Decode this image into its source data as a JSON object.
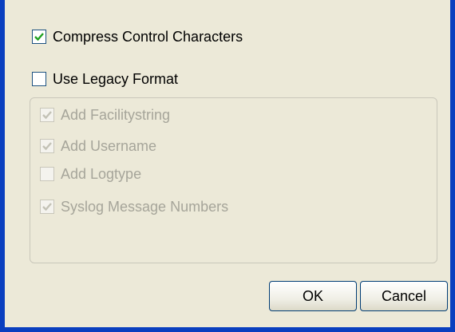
{
  "options": {
    "compress": {
      "label": "Compress Control Characters",
      "checked": true,
      "enabled": true
    },
    "legacy": {
      "label": "Use Legacy Format",
      "checked": false,
      "enabled": true
    }
  },
  "legacy_options": [
    {
      "label": "Add Facilitystring",
      "checked": true,
      "enabled": false
    },
    {
      "label": "Add Username",
      "checked": true,
      "enabled": false
    },
    {
      "label": "Add Logtype",
      "checked": false,
      "enabled": false
    },
    {
      "label": "Syslog Message Numbers",
      "checked": true,
      "enabled": false
    }
  ],
  "buttons": {
    "ok": "OK",
    "cancel": "Cancel"
  },
  "colors": {
    "window_border": "#0a3fbf",
    "background": "#ece9d8",
    "check_enabled": "#21a121",
    "check_disabled": "#c3c2b6"
  }
}
